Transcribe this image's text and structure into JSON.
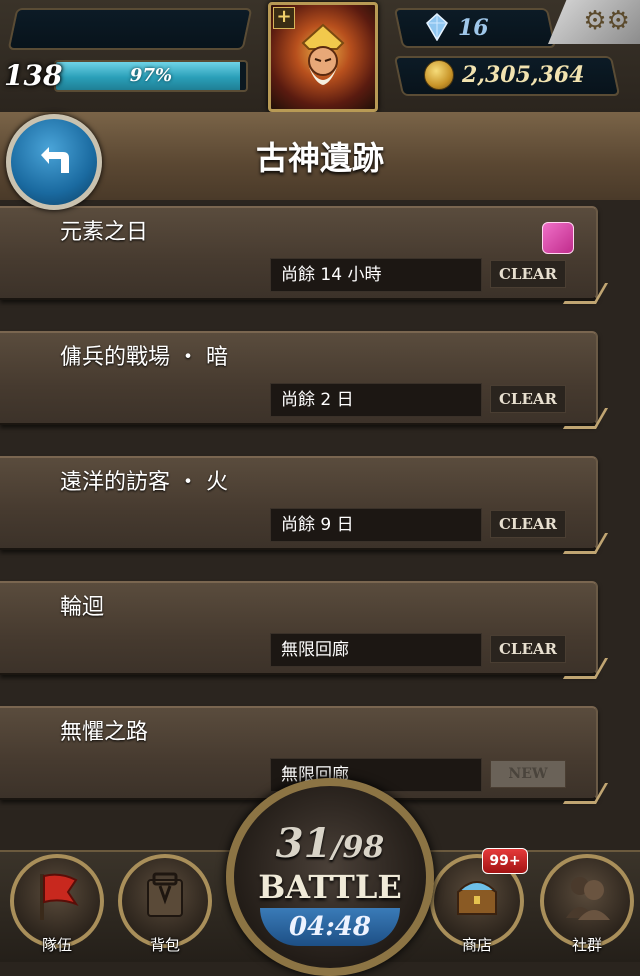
{
  "header": {
    "level": "138",
    "exp_percent": "97%",
    "exp_fraction": 0.97,
    "gems": "16",
    "coins": "2,305,364"
  },
  "page": {
    "title": "古神遺跡"
  },
  "stages": [
    {
      "name": "元素之日",
      "time": "尚餘 14 小時",
      "status": "CLEAR",
      "badge": true
    },
    {
      "name": "傭兵的戰場 ・ 暗",
      "time": "尚餘 2 日",
      "status": "CLEAR",
      "badge": false
    },
    {
      "name": "遠洋的訪客 ・ 火",
      "time": "尚餘 9 日",
      "status": "CLEAR",
      "badge": false
    },
    {
      "name": "輪迴",
      "time": "無限回廊",
      "status": "CLEAR",
      "badge": false
    },
    {
      "name": "無懼之路",
      "time": "無限回廊",
      "status": "NEW",
      "badge": false
    }
  ],
  "battle": {
    "current": "31",
    "separator": "/",
    "max": "98",
    "label": "BATTLE",
    "timer": "04:48"
  },
  "nav": {
    "team": "隊伍",
    "bag": "背包",
    "shop": "商店",
    "social": "社群",
    "shop_badge": "99+"
  },
  "colors": {
    "exp_bar": "#2a9fb8",
    "back_button": "#1a6aa0",
    "battle_timer": "#1d4f85",
    "shop_badge": "#c41a1a"
  }
}
